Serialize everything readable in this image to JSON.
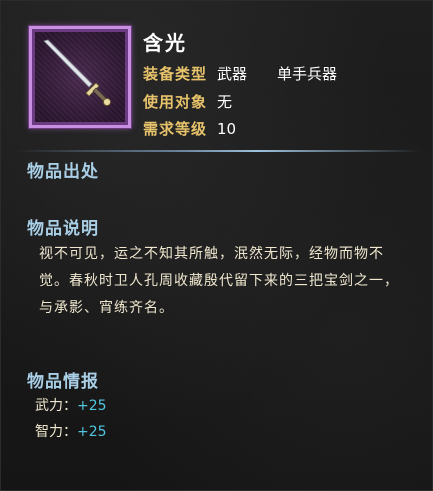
{
  "item": {
    "name": "含光",
    "attrs": {
      "type_label": "装备类型",
      "type_value": "武器",
      "type_sub": "单手兵器",
      "target_label": "使用对象",
      "target_value": "无",
      "level_label": "需求等级",
      "level_value": "10"
    },
    "icon": "sword-icon",
    "frame_color": "#c88fe0"
  },
  "sections": {
    "source_title": "物品出处",
    "desc_title": "物品说明",
    "desc_text": "视不可见，运之不知其所触，泯然无际，经物而物不觉。春秋时卫人孔周收藏殷代留下来的三把宝剑之一，与承影、宵练齐名。",
    "info_title": "物品情报",
    "stats": [
      {
        "label": "武力：",
        "value": "+25"
      },
      {
        "label": "智力：",
        "value": "+25"
      }
    ]
  },
  "colors": {
    "label_gold": "#e6c26a",
    "section_blue": "#a9cfe6",
    "stat_cyan": "#4fc6df"
  }
}
